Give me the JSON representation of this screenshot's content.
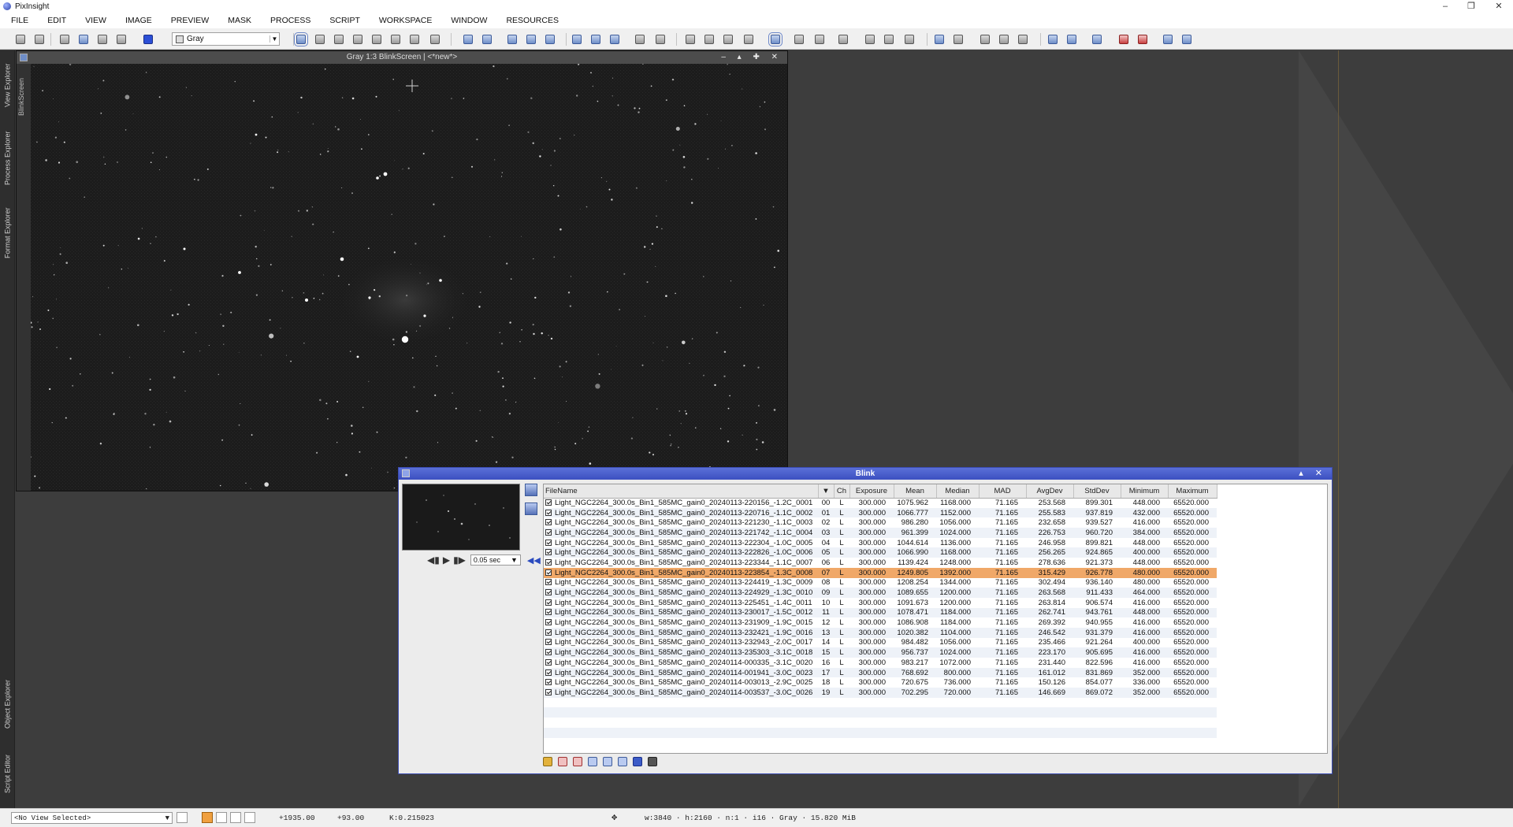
{
  "app": {
    "title": "PixInsight",
    "menu": [
      "FILE",
      "EDIT",
      "VIEW",
      "IMAGE",
      "PREVIEW",
      "MASK",
      "PROCESS",
      "SCRIPT",
      "WORKSPACE",
      "WINDOW",
      "RESOURCES"
    ],
    "view_selector": "Gray"
  },
  "left_panel": {
    "tabs": [
      "View Explorer",
      "Process Explorer",
      "Format Explorer",
      "Object Explorer",
      "Script Editor"
    ]
  },
  "image_window": {
    "title": "Gray 1:3 BlinkScreen | <*new*>",
    "side_tab": "BlinkScreen"
  },
  "blink": {
    "title": "Blink",
    "speed": "0.05 sec",
    "columns": [
      "FileName",
      "",
      "Ch",
      "Exposure",
      "Mean",
      "Median",
      "MAD",
      "AvgDev",
      "StdDev",
      "Minimum",
      "Maximum"
    ],
    "selected_index": 7,
    "rows": [
      {
        "file": "Light_NGC2264_300.0s_Bin1_585MC_gain0_20240113-220156_-1.2C_0001",
        "n": "00",
        "ch": "L",
        "exposure": "300.000",
        "mean": "1075.962",
        "median": "1168.000",
        "mad": "71.165",
        "avgdev": "253.568",
        "stddev": "899.301",
        "min": "448.000",
        "max": "65520.000"
      },
      {
        "file": "Light_NGC2264_300.0s_Bin1_585MC_gain0_20240113-220716_-1.1C_0002",
        "n": "01",
        "ch": "L",
        "exposure": "300.000",
        "mean": "1066.777",
        "median": "1152.000",
        "mad": "71.165",
        "avgdev": "255.583",
        "stddev": "937.819",
        "min": "432.000",
        "max": "65520.000"
      },
      {
        "file": "Light_NGC2264_300.0s_Bin1_585MC_gain0_20240113-221230_-1.1C_0003",
        "n": "02",
        "ch": "L",
        "exposure": "300.000",
        "mean": "986.280",
        "median": "1056.000",
        "mad": "71.165",
        "avgdev": "232.658",
        "stddev": "939.527",
        "min": "416.000",
        "max": "65520.000"
      },
      {
        "file": "Light_NGC2264_300.0s_Bin1_585MC_gain0_20240113-221742_-1.1C_0004",
        "n": "03",
        "ch": "L",
        "exposure": "300.000",
        "mean": "961.399",
        "median": "1024.000",
        "mad": "71.165",
        "avgdev": "226.753",
        "stddev": "960.720",
        "min": "384.000",
        "max": "65520.000"
      },
      {
        "file": "Light_NGC2264_300.0s_Bin1_585MC_gain0_20240113-222304_-1.0C_0005",
        "n": "04",
        "ch": "L",
        "exposure": "300.000",
        "mean": "1044.614",
        "median": "1136.000",
        "mad": "71.165",
        "avgdev": "246.958",
        "stddev": "899.821",
        "min": "448.000",
        "max": "65520.000"
      },
      {
        "file": "Light_NGC2264_300.0s_Bin1_585MC_gain0_20240113-222826_-1.0C_0006",
        "n": "05",
        "ch": "L",
        "exposure": "300.000",
        "mean": "1066.990",
        "median": "1168.000",
        "mad": "71.165",
        "avgdev": "256.265",
        "stddev": "924.865",
        "min": "400.000",
        "max": "65520.000"
      },
      {
        "file": "Light_NGC2264_300.0s_Bin1_585MC_gain0_20240113-223344_-1.1C_0007",
        "n": "06",
        "ch": "L",
        "exposure": "300.000",
        "mean": "1139.424",
        "median": "1248.000",
        "mad": "71.165",
        "avgdev": "278.636",
        "stddev": "921.373",
        "min": "448.000",
        "max": "65520.000"
      },
      {
        "file": "Light_NGC2264_300.0s_Bin1_585MC_gain0_20240113-223854_-1.3C_0008",
        "n": "07",
        "ch": "L",
        "exposure": "300.000",
        "mean": "1249.805",
        "median": "1392.000",
        "mad": "71.165",
        "avgdev": "315.429",
        "stddev": "926.778",
        "min": "480.000",
        "max": "65520.000"
      },
      {
        "file": "Light_NGC2264_300.0s_Bin1_585MC_gain0_20240113-224419_-1.3C_0009",
        "n": "08",
        "ch": "L",
        "exposure": "300.000",
        "mean": "1208.254",
        "median": "1344.000",
        "mad": "71.165",
        "avgdev": "302.494",
        "stddev": "936.140",
        "min": "480.000",
        "max": "65520.000"
      },
      {
        "file": "Light_NGC2264_300.0s_Bin1_585MC_gain0_20240113-224929_-1.3C_0010",
        "n": "09",
        "ch": "L",
        "exposure": "300.000",
        "mean": "1089.655",
        "median": "1200.000",
        "mad": "71.165",
        "avgdev": "263.568",
        "stddev": "911.433",
        "min": "464.000",
        "max": "65520.000"
      },
      {
        "file": "Light_NGC2264_300.0s_Bin1_585MC_gain0_20240113-225451_-1.4C_0011",
        "n": "10",
        "ch": "L",
        "exposure": "300.000",
        "mean": "1091.673",
        "median": "1200.000",
        "mad": "71.165",
        "avgdev": "263.814",
        "stddev": "906.574",
        "min": "416.000",
        "max": "65520.000"
      },
      {
        "file": "Light_NGC2264_300.0s_Bin1_585MC_gain0_20240113-230017_-1.5C_0012",
        "n": "11",
        "ch": "L",
        "exposure": "300.000",
        "mean": "1078.471",
        "median": "1184.000",
        "mad": "71.165",
        "avgdev": "262.741",
        "stddev": "943.761",
        "min": "448.000",
        "max": "65520.000"
      },
      {
        "file": "Light_NGC2264_300.0s_Bin1_585MC_gain0_20240113-231909_-1.9C_0015",
        "n": "12",
        "ch": "L",
        "exposure": "300.000",
        "mean": "1086.908",
        "median": "1184.000",
        "mad": "71.165",
        "avgdev": "269.392",
        "stddev": "940.955",
        "min": "416.000",
        "max": "65520.000"
      },
      {
        "file": "Light_NGC2264_300.0s_Bin1_585MC_gain0_20240113-232421_-1.9C_0016",
        "n": "13",
        "ch": "L",
        "exposure": "300.000",
        "mean": "1020.382",
        "median": "1104.000",
        "mad": "71.165",
        "avgdev": "246.542",
        "stddev": "931.379",
        "min": "416.000",
        "max": "65520.000"
      },
      {
        "file": "Light_NGC2264_300.0s_Bin1_585MC_gain0_20240113-232943_-2.0C_0017",
        "n": "14",
        "ch": "L",
        "exposure": "300.000",
        "mean": "984.482",
        "median": "1056.000",
        "mad": "71.165",
        "avgdev": "235.466",
        "stddev": "921.264",
        "min": "400.000",
        "max": "65520.000"
      },
      {
        "file": "Light_NGC2264_300.0s_Bin1_585MC_gain0_20240113-235303_-3.1C_0018",
        "n": "15",
        "ch": "L",
        "exposure": "300.000",
        "mean": "956.737",
        "median": "1024.000",
        "mad": "71.165",
        "avgdev": "223.170",
        "stddev": "905.695",
        "min": "416.000",
        "max": "65520.000"
      },
      {
        "file": "Light_NGC2264_300.0s_Bin1_585MC_gain0_20240114-000335_-3.1C_0020",
        "n": "16",
        "ch": "L",
        "exposure": "300.000",
        "mean": "983.217",
        "median": "1072.000",
        "mad": "71.165",
        "avgdev": "231.440",
        "stddev": "822.596",
        "min": "416.000",
        "max": "65520.000"
      },
      {
        "file": "Light_NGC2264_300.0s_Bin1_585MC_gain0_20240114-001941_-3.0C_0023",
        "n": "17",
        "ch": "L",
        "exposure": "300.000",
        "mean": "768.692",
        "median": "800.000",
        "mad": "71.165",
        "avgdev": "161.012",
        "stddev": "831.869",
        "min": "352.000",
        "max": "65520.000"
      },
      {
        "file": "Light_NGC2264_300.0s_Bin1_585MC_gain0_20240114-003013_-2.9C_0025",
        "n": "18",
        "ch": "L",
        "exposure": "300.000",
        "mean": "720.675",
        "median": "736.000",
        "mad": "71.165",
        "avgdev": "150.126",
        "stddev": "854.077",
        "min": "336.000",
        "max": "65520.000"
      },
      {
        "file": "Light_NGC2264_300.0s_Bin1_585MC_gain0_20240114-003537_-3.0C_0026",
        "n": "19",
        "ch": "L",
        "exposure": "300.000",
        "mean": "702.295",
        "median": "720.000",
        "mad": "71.165",
        "avgdev": "146.669",
        "stddev": "869.072",
        "min": "352.000",
        "max": "65520.000"
      }
    ]
  },
  "status": {
    "view_selector": "<No View Selected>",
    "x": "+1935.00",
    "y": "+93.00",
    "k": "K:0.215023",
    "info": "w:3840 · h:2160 · n:1 · i16 · Gray · 15.820 MiB"
  }
}
